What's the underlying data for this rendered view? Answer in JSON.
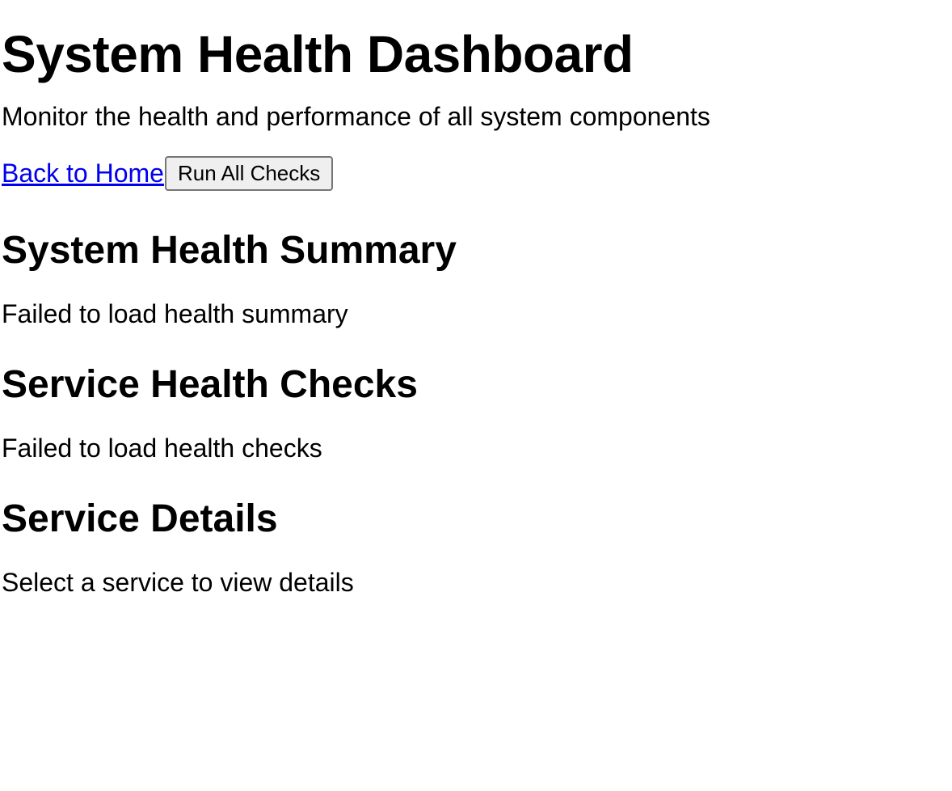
{
  "header": {
    "title": "System Health Dashboard",
    "subtitle": "Monitor the health and performance of all system components"
  },
  "actions": {
    "home_link": "Back to Home",
    "run_all_button": "Run All Checks"
  },
  "sections": [
    {
      "title": "System Health Summary",
      "message": "Failed to load health summary"
    },
    {
      "title": "Service Health Checks",
      "message": "Failed to load health checks"
    },
    {
      "title": "Service Details",
      "message": "Select a service to view details"
    }
  ],
  "colors": {
    "link": "#0000ee",
    "button_bg": "#efefef",
    "button_border": "#767676"
  }
}
